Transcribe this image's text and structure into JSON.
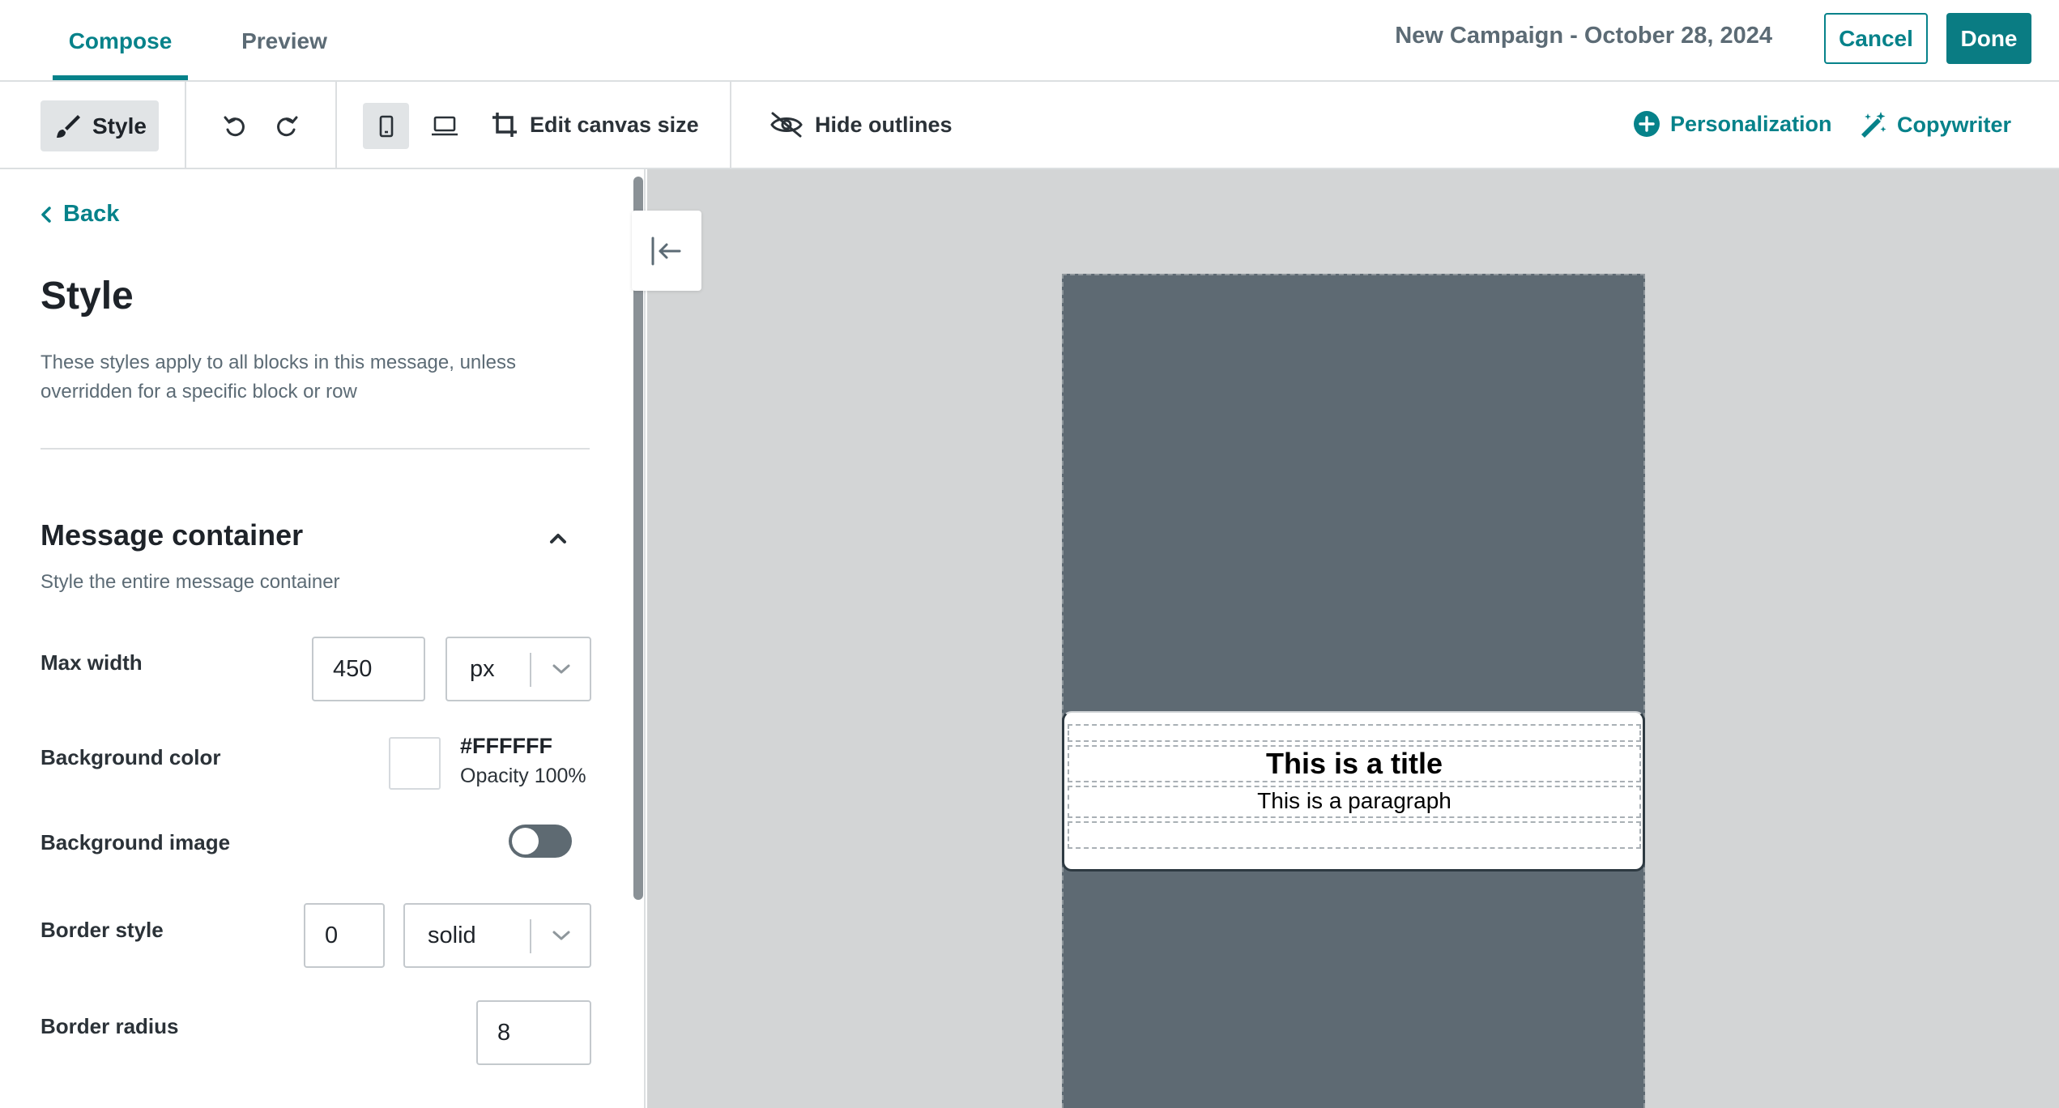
{
  "header": {
    "tabs": [
      {
        "label": "Compose",
        "active": true
      },
      {
        "label": "Preview",
        "active": false
      }
    ],
    "campaign_name": "New Campaign - October 28, 2024",
    "cancel_label": "Cancel",
    "done_label": "Done"
  },
  "toolbar": {
    "style_label": "Style",
    "edit_canvas_label": "Edit canvas size",
    "hide_outlines_label": "Hide outlines",
    "personalization_label": "Personalization",
    "copywriter_label": "Copywriter",
    "active_device": "mobile",
    "icons": [
      "paintbrush-icon",
      "undo-icon",
      "redo-icon",
      "mobile-icon",
      "desktop-icon",
      "crop-icon",
      "eye-slash-icon",
      "plus-circle-icon",
      "magic-wand-icon"
    ]
  },
  "panel": {
    "back_label": "Back",
    "title": "Style",
    "description": "These styles apply to all blocks in this message, unless overridden for a specific block or row",
    "section": {
      "title": "Message container",
      "description": "Style the entire message container",
      "expanded": true
    },
    "fields": {
      "max_width": {
        "label": "Max width",
        "value": "450",
        "unit": "px"
      },
      "background_color": {
        "label": "Background color",
        "hex": "#FFFFFF",
        "opacity": "Opacity 100%"
      },
      "background_image": {
        "label": "Background image",
        "enabled": false
      },
      "border_style": {
        "label": "Border style",
        "width": "0",
        "style": "solid"
      },
      "border_radius": {
        "label": "Border radius",
        "value": "8"
      }
    }
  },
  "canvas": {
    "title": "This is a title",
    "paragraph": "This is a paragraph"
  },
  "colors": {
    "accent": "#06828a",
    "canvas_bg": "#d3d5d6",
    "phone_bg": "#5e6a73"
  }
}
